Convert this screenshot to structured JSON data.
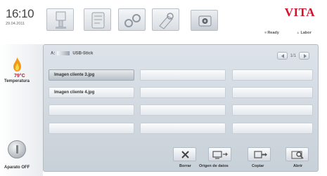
{
  "header": {
    "time": "16:10",
    "date": "29.04.2011",
    "brand": "VITA",
    "status": [
      "Ready",
      "Labor"
    ]
  },
  "tabs": [
    {
      "icon": "furnace-icon"
    },
    {
      "icon": "program-icon"
    },
    {
      "icon": "settings-icon"
    },
    {
      "icon": "tools-icon"
    },
    {
      "icon": "camera-icon",
      "active": true
    }
  ],
  "sidebar": {
    "temperature_value": "79°C",
    "temperature_label": "Temperatura",
    "power_label": "Aparato OFF"
  },
  "browser": {
    "path_prefix": "A:",
    "path_name": "USB-Stick",
    "page": "1/1",
    "files": [
      "Imagen cliente 3.jpg",
      "",
      "",
      "Imagen cliente 4.jpg",
      "",
      "",
      "",
      "",
      "",
      "",
      "",
      ""
    ],
    "selected_index": 0
  },
  "actions": {
    "delete": "Borrar",
    "source": "Origen de datos",
    "copy": "Copiar",
    "open": "Abrir"
  },
  "colors": {
    "brand": "#d2112d",
    "temperature": "#d2112d",
    "panel": "#d3dae1"
  }
}
